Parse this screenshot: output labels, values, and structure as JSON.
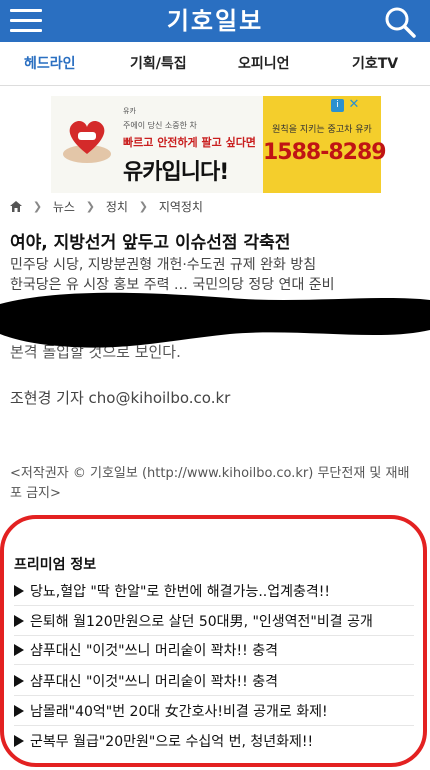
{
  "header": {
    "logo": "기호일보"
  },
  "nav": {
    "tabs": [
      {
        "label": "헤드라인"
      },
      {
        "label": "기획/특집"
      },
      {
        "label": "오피니언"
      },
      {
        "label": "기호TV"
      }
    ]
  },
  "ad": {
    "small_line1": "유카",
    "small_line2": "주에이 당신 소중한 차",
    "tagline": "빠르고 안전하게 팔고 싶다면",
    "big_text": "유카입니다!",
    "right_line": "원칙을 지키는 중고차 유카",
    "phone": "1588-8289",
    "info_tag": "i",
    "close": "✕"
  },
  "breadcrumb": {
    "items": [
      "뉴스",
      "정치",
      "지역정치"
    ]
  },
  "article": {
    "headline": "여야, 지방선거 앞두고 이슈선점 각축전",
    "summary_lines": [
      "민주당 시당, 지방분권형 개헌·수도권 규제 완화 방침",
      "한국당은 유 시장 홍보 주력 … 국민의당 정당 연대 준비"
    ],
    "partial_body": "본격 돌입할 것으로 보인다.",
    "reporter": "조현경 기자 cho@kihoilbo.co.kr",
    "copyright": "<저작권자 © 기호일보 (http://www.kihoilbo.co.kr) 무단전재 및 재배포 금지>"
  },
  "premium": {
    "title": "프리미엄 정보",
    "items": [
      "당뇨,혈압 \"딱 한알\"로 한번에 해결가능..업계충격!!",
      "은퇴해 월120만원으로 살던 50대男, \"인생역전\"비결 공개",
      "샴푸대신 \"이것\"쓰니 머리숱이 꽉차!! 충격",
      "샴푸대신 \"이것\"쓰니 머리숱이 꽉차!! 충격",
      "남몰래\"40억\"번 20대 女간호사!비결 공개로 화제!",
      "군복무 월급\"20만원\"으로 수십억 번, 청년화제!!"
    ]
  },
  "colors": {
    "brand_blue": "#2a6fc1",
    "highlight_red": "#e32121",
    "ad_yellow": "#f4ce2c"
  }
}
